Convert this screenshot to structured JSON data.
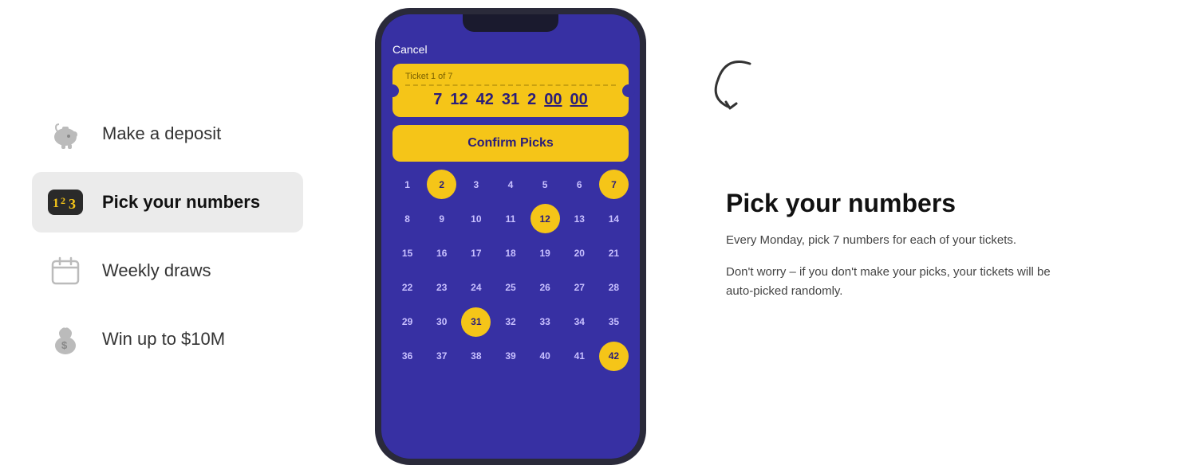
{
  "sidebar": {
    "items": [
      {
        "id": "deposit",
        "label": "Make a deposit",
        "active": false,
        "icon": "piggy-bank-icon"
      },
      {
        "id": "pick-numbers",
        "label": "Pick your numbers",
        "active": true,
        "icon": "numbers-icon"
      },
      {
        "id": "weekly-draws",
        "label": "Weekly draws",
        "active": false,
        "icon": "calendar-icon"
      },
      {
        "id": "win",
        "label": "Win up to $10M",
        "active": false,
        "icon": "money-bag-icon"
      }
    ]
  },
  "phone": {
    "cancel_label": "Cancel",
    "ticket": {
      "label": "Ticket 1 of 7",
      "numbers": [
        "7",
        "12",
        "42",
        "31",
        "2"
      ],
      "placeholders": [
        "00",
        "00"
      ]
    },
    "confirm_button": "Confirm Picks",
    "grid": {
      "numbers": [
        1,
        2,
        3,
        4,
        5,
        6,
        7,
        8,
        9,
        10,
        11,
        12,
        13,
        14,
        15,
        16,
        17,
        18,
        19,
        20,
        21,
        22,
        23,
        24,
        25,
        26,
        27,
        28,
        29,
        30,
        31,
        32,
        33,
        34,
        35,
        36,
        37,
        38,
        39,
        40,
        41,
        42
      ],
      "selected": [
        2,
        7,
        12,
        31,
        42
      ]
    }
  },
  "info": {
    "title": "Pick your numbers",
    "paragraph1": "Every Monday, pick 7 numbers for each of your tickets.",
    "paragraph2": "Don't worry – if you don't make your picks, your tickets will be auto-picked randomly."
  },
  "colors": {
    "purple": "#3730a3",
    "yellow": "#f5c518",
    "dark_text": "#111111",
    "body_text": "#444444"
  }
}
